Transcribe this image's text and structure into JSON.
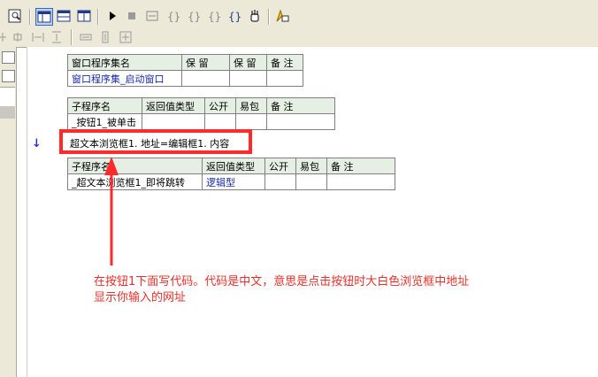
{
  "toolbar": {
    "icons": [
      "preview-icon",
      "layout-icon",
      "window-icon",
      "panel-icon",
      "run-icon",
      "stop-icon",
      "step-icon",
      "step-into-icon",
      "step-out-icon",
      "run-to-cursor-icon",
      "variable-icon",
      "hand-icon",
      "help-icon"
    ],
    "layout_icons": [
      "align-left-icon",
      "align-center-icon",
      "align-hspace-icon",
      "align-vspace-icon",
      "same-width-icon",
      "same-height-icon",
      "same-size-icon"
    ]
  },
  "table_assembly": {
    "headers": [
      "窗口程序集名",
      "保 留",
      "保 留",
      "备 注"
    ],
    "row": [
      "窗口程序集_启动窗口",
      "",
      "",
      ""
    ]
  },
  "table_sub1": {
    "headers": [
      "子程序名",
      "返回值类型",
      "公开",
      "易包",
      "备 注"
    ],
    "row": [
      "_按钮1_被单击",
      "",
      "",
      "",
      ""
    ]
  },
  "code_line": "超文本浏览框1. 地址=编辑框1. 内容",
  "table_sub2": {
    "headers": [
      "子程序名",
      "返回值类型",
      "公开",
      "易包",
      "备 注"
    ],
    "row": [
      "_超文本浏览框1_即将跳转",
      "逻辑型",
      "",
      "",
      ""
    ]
  },
  "annotation": {
    "line1": "在按钮1下面写代码。代码是中文，意思是点击按钮时大白色浏览框中地址",
    "line2": "显示你输入的网址"
  },
  "colors": {
    "annotation": "#e8302a",
    "header_bg": "#e6efe3",
    "link_blue": "#1a2aa8"
  }
}
